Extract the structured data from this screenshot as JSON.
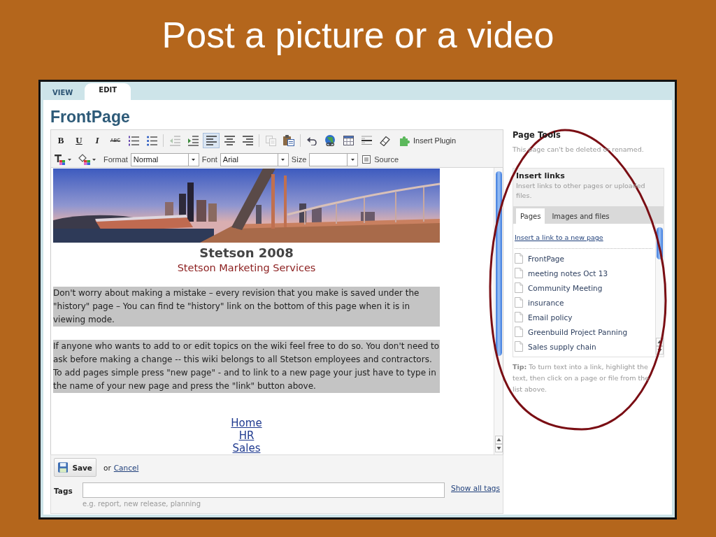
{
  "slide": {
    "title": "Post a picture or a video"
  },
  "tabs": [
    {
      "label": "VIEW",
      "selected": false
    },
    {
      "label": "EDIT",
      "selected": true
    }
  ],
  "page": {
    "title": "FrontPage"
  },
  "editor": {
    "toolbar": {
      "row_1": [
        [
          {
            "kind": "bold",
            "label": "B",
            "selected": false,
            "disabled": false
          },
          {
            "kind": "underline",
            "label": "U",
            "selected": false,
            "disabled": false
          },
          {
            "kind": "italic",
            "label": "I",
            "selected": false,
            "disabled": false
          },
          {
            "kind": "strike",
            "label": "ABC",
            "selected": false,
            "disabled": false
          },
          {
            "kind": "numbered",
            "selected": false,
            "disabled": false
          },
          {
            "kind": "bulleted",
            "selected": false,
            "disabled": false
          }
        ],
        [
          {
            "kind": "outdent",
            "selected": false,
            "disabled": true
          },
          {
            "kind": "indent",
            "selected": false,
            "disabled": false
          },
          {
            "kind": "alignleft",
            "selected": true,
            "disabled": false
          },
          {
            "kind": "center",
            "selected": false,
            "disabled": false
          },
          {
            "kind": "alignright",
            "selected": false,
            "disabled": false
          }
        ],
        [
          {
            "kind": "copy",
            "selected": false,
            "disabled": true
          },
          {
            "kind": "paste",
            "selected": false,
            "disabled": false
          }
        ],
        [
          {
            "kind": "undo",
            "selected": false,
            "disabled": false
          },
          {
            "kind": "link",
            "selected": false,
            "disabled": false
          },
          {
            "kind": "table",
            "selected": false,
            "disabled": false
          },
          {
            "kind": "rule",
            "selected": false,
            "disabled": false
          },
          {
            "kind": "eraser",
            "selected": false,
            "disabled": false
          },
          {
            "kind": "plugin",
            "label": "Insert Plugin",
            "selected": false,
            "disabled": false
          }
        ]
      ],
      "row_2": [
        {
          "kind": "textcolor"
        },
        {
          "kind": "bgcolor"
        },
        {
          "kind": "select",
          "label": "Format",
          "value": "Normal"
        },
        {
          "kind": "select",
          "label": "Font",
          "value": "Arial"
        },
        {
          "kind": "select",
          "label": "Size"
        },
        {
          "kind": "source",
          "label": "Source"
        }
      ]
    },
    "content": {
      "heading": "Stetson 2008",
      "subheading": "Stetson Marketing Services",
      "paragraphs": [
        {
          "text": "Don't worry about making a mistake – every revision that you make is saved under the \"history\" page – You can find te \"history\" link on the bottom of this page when it is in viewing mode.",
          "highlighted": true
        },
        {
          "text": "If anyone who wants to add to or edit topics on the wiki feel free to do so. You don't need to ask before making a change -- this wiki belongs to all Stetson employees and contractors. To add pages simple press \"new page\" - and to link to a new page your just have to type in the name of your new page and press the \"link\" button above.",
          "highlighted": true
        }
      ],
      "links": [
        "Home",
        "HR",
        "Sales"
      ]
    },
    "save_button": "Save",
    "or_text": "or",
    "cancel_link": "Cancel",
    "tags": {
      "label": "Tags",
      "hint": "e.g. report, new release, planning",
      "show_all_link": "Show all tags"
    }
  },
  "page_tools": {
    "title": "Page Tools",
    "note": "This page can't be deleted or renamed.",
    "insert_links": {
      "title": "Insert links",
      "description": "Insert links to other pages or uploaded files.",
      "tabs": [
        {
          "label": "Pages",
          "selected": true
        },
        {
          "label": "Images and files",
          "selected": false
        }
      ],
      "new_page_link": "Insert a link to a new page",
      "pages": [
        "FrontPage",
        "meeting notes Oct 13",
        "Community Meeting",
        "insurance",
        "Email policy",
        "Greenbuild Project Panning",
        "Sales supply chain"
      ]
    },
    "tip": "**Tip:** To turn text into a link, highlight the text, then click on a page or file from the list above."
  }
}
